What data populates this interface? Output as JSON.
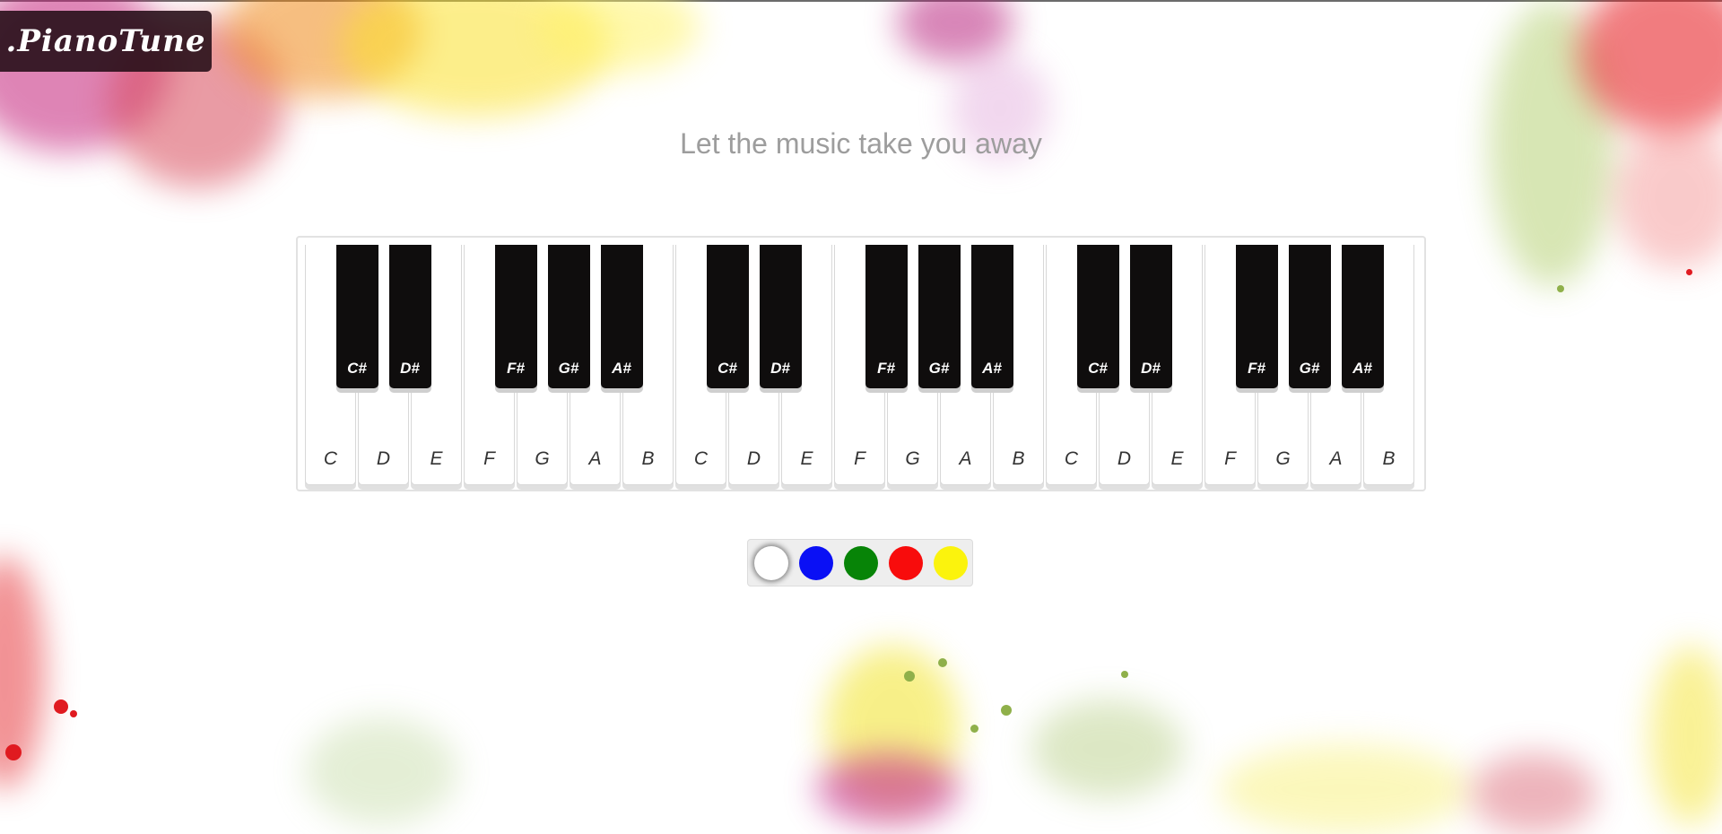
{
  "app": {
    "logo_text": ".PianoTune",
    "tagline": "Let the music take you away"
  },
  "piano": {
    "white_keys": [
      "C",
      "D",
      "E",
      "F",
      "G",
      "A",
      "B",
      "C",
      "D",
      "E",
      "F",
      "G",
      "A",
      "B",
      "C",
      "D",
      "E",
      "F",
      "G",
      "A",
      "B"
    ],
    "black_keys": [
      "C#",
      "D#",
      "F#",
      "G#",
      "A#",
      "C#",
      "D#",
      "F#",
      "G#",
      "A#",
      "C#",
      "D#",
      "F#",
      "G#",
      "A#"
    ]
  },
  "palette": {
    "colors": [
      {
        "name": "white",
        "hex": "#ffffff",
        "selected": true
      },
      {
        "name": "blue",
        "hex": "#0a10f5",
        "selected": false
      },
      {
        "name": "green",
        "hex": "#078407",
        "selected": false
      },
      {
        "name": "red",
        "hex": "#f80c0c",
        "selected": false
      },
      {
        "name": "yellow",
        "hex": "#fbf30d",
        "selected": false
      }
    ]
  }
}
